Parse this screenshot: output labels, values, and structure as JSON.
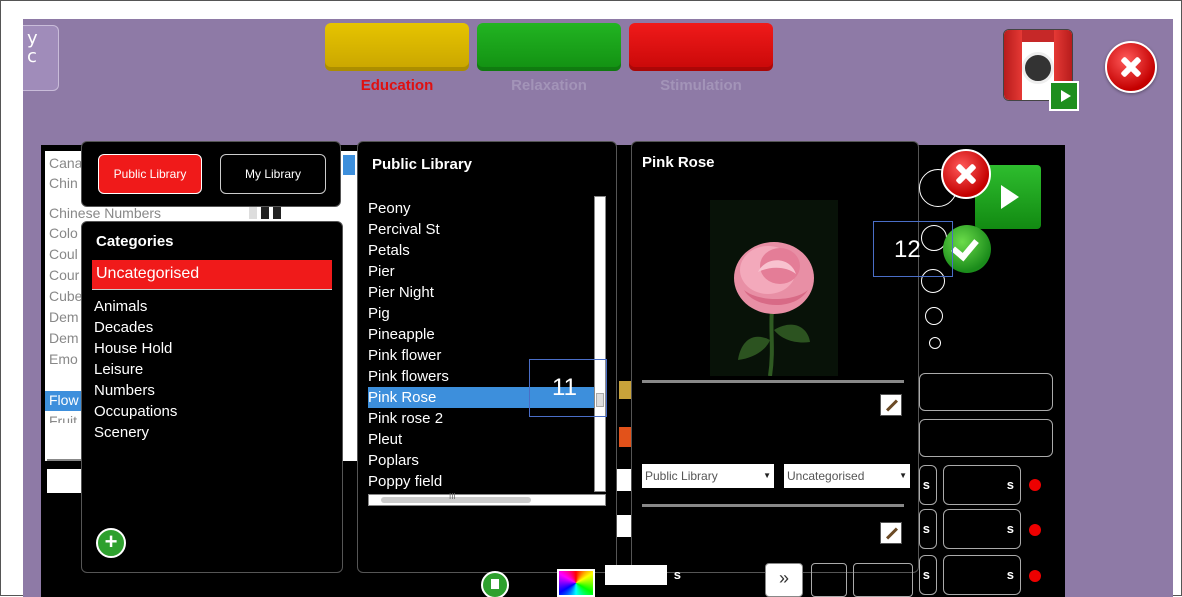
{
  "app": {
    "logo_text": "y\nc"
  },
  "modes": [
    {
      "label": "Education",
      "color": "#d7b200",
      "label_color": "#e01010"
    },
    {
      "label": "Relaxation",
      "color": "#18a018",
      "label_color": "#a394b8"
    },
    {
      "label": "Stimulation",
      "color": "#e01010",
      "label_color": "#a394b8"
    }
  ],
  "background_list": {
    "items": [
      "Cana",
      "Chin",
      "Chinese Numbers",
      "Colo",
      "Coul",
      "Cour",
      "Cube",
      "Dem",
      "Dem",
      "Emo",
      "Flow",
      "Fruit"
    ]
  },
  "library_tabs": {
    "public": "Public Library",
    "mine": "My Library"
  },
  "categories": {
    "title": "Categories",
    "selected": "Uncategorised",
    "items": [
      "Animals",
      "Decades",
      "House Hold",
      "Leisure",
      "Numbers",
      "Occupations",
      "Scenery"
    ]
  },
  "public_library": {
    "title": "Public Library",
    "items": [
      "Peony",
      "Percival St",
      "Petals",
      "Pier",
      "Pier Night",
      "Pig",
      "Pineapple",
      "Pink flower",
      "Pink flowers",
      "Pink Rose",
      "Pink rose 2",
      "Pleut",
      "Poplars",
      "Poppy field"
    ],
    "selected": "Pink Rose",
    "scroll_h_label": "III"
  },
  "detail": {
    "title": "Pink Rose",
    "library_dropdown": "Public Library",
    "category_dropdown": "Uncategorised"
  },
  "annotations": {
    "a11": "11",
    "a12": "12"
  },
  "timer_rows": [
    {
      "unit_a": "s",
      "unit_b": "s"
    },
    {
      "unit_a": "s",
      "unit_b": "s"
    },
    {
      "unit_a": "s",
      "unit_b": "s"
    }
  ],
  "bottom": {
    "seconds_unit": "s",
    "forward_glyph": "»"
  }
}
